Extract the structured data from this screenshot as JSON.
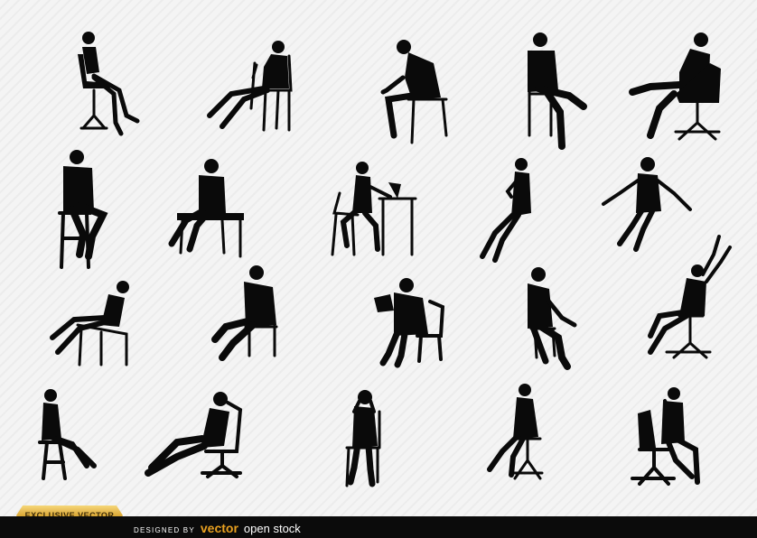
{
  "badge": {
    "text": "EXCLUSIVE VECTOR",
    "color": "#d9a531"
  },
  "footer": {
    "designed_by": "DESIGNED BY",
    "brand": "vector",
    "brand_suffix": "open stock",
    "brand_color": "#e8a020",
    "background": "#0b0b0b"
  },
  "silhouettes": [
    {
      "id": "woman-office-chair",
      "pose": "sitting on swivel chair, legs crossed"
    },
    {
      "id": "woman-leaning-chair",
      "pose": "reclined on chair, holding cane"
    },
    {
      "id": "man-phone-chair",
      "pose": "leaning forward on chair looking at phone"
    },
    {
      "id": "man-chair-leg-crossed",
      "pose": "sitting upright, one leg crossed"
    },
    {
      "id": "man-armchair-relaxed",
      "pose": "relaxed in office armchair"
    },
    {
      "id": "man-bar-stool",
      "pose": "sitting on tall stool"
    },
    {
      "id": "man-bench",
      "pose": "sitting on small table"
    },
    {
      "id": "woman-laptop-desk",
      "pose": "sitting at desk with laptop"
    },
    {
      "id": "woman-perched",
      "pose": "perched with legs crossed, holding cup"
    },
    {
      "id": "woman-arms-spread",
      "pose": "sitting with arms spread"
    },
    {
      "id": "woman-lounge-chair",
      "pose": "reclining on lounge chair"
    },
    {
      "id": "man-slumped-chair",
      "pose": "slumped on chair, legs stretched"
    },
    {
      "id": "person-reading",
      "pose": "reading on chair"
    },
    {
      "id": "man-thinking-chair",
      "pose": "sitting with hand to chin"
    },
    {
      "id": "woman-arms-raised",
      "pose": "on swivel chair, arms raised"
    },
    {
      "id": "woman-stool",
      "pose": "sitting on stool"
    },
    {
      "id": "man-reclined-office",
      "pose": "reclined in office chair, hands behind head"
    },
    {
      "id": "person-chair-hands-face",
      "pose": "sitting on chair, hands to face"
    },
    {
      "id": "woman-swivel-crossed",
      "pose": "on swivel stool, legs crossed"
    },
    {
      "id": "woman-office-chair-phone",
      "pose": "on office chair, on the phone"
    }
  ]
}
